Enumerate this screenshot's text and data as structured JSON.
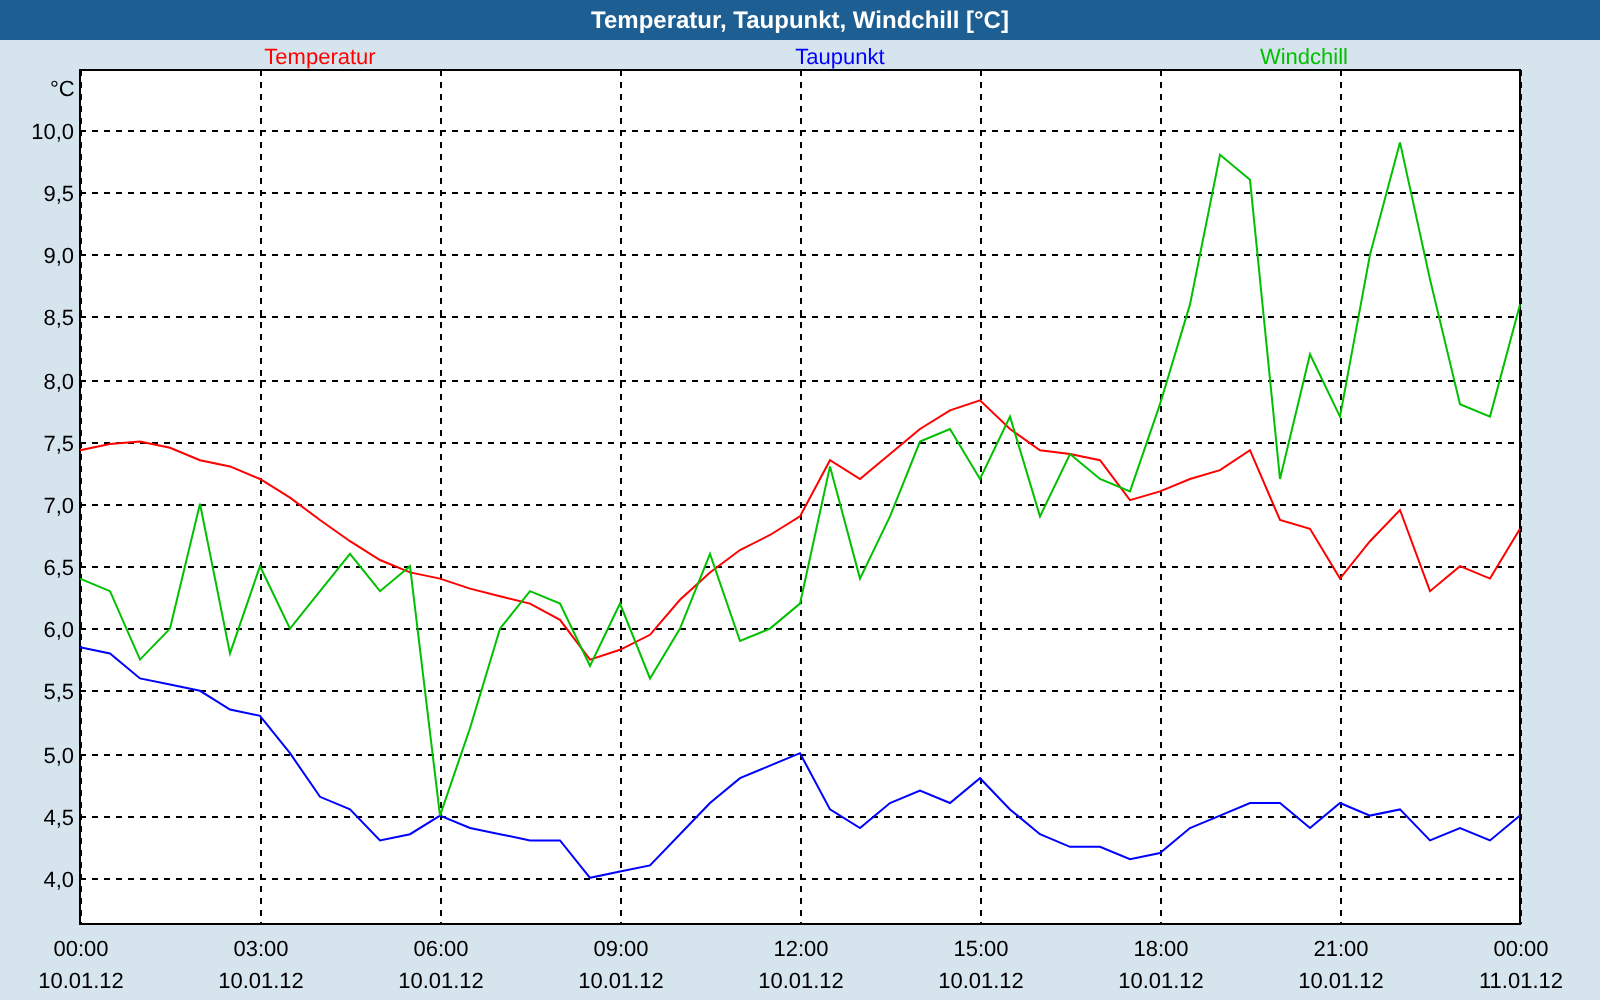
{
  "window": {
    "title": "Temperatur, Taupunkt, Windchill [°C]"
  },
  "chart": {
    "chart_data": {
      "type": "line",
      "ylabel": "°C",
      "categories": [
        "00:00 10.01.12",
        null,
        null,
        null,
        null,
        null,
        "03:00 10.01.12",
        null,
        null,
        null,
        null,
        null,
        "06:00 10.01.12",
        null,
        null,
        null,
        null,
        null,
        "09:00 10.01.12",
        null,
        null,
        null,
        null,
        null,
        "12:00 10.01.12",
        null,
        null,
        null,
        null,
        null,
        "15:00 10.01.12",
        null,
        null,
        null,
        null,
        null,
        "18:00 10.01.12",
        null,
        null,
        null,
        null,
        null,
        "21:00 10.01.12",
        null,
        null,
        null,
        null,
        null,
        "00:00 11.01.12"
      ],
      "series": [
        {
          "name": "Temperatur",
          "color": "#ff0000",
          "values": [
            7.43,
            7.48,
            7.5,
            7.45,
            7.35,
            7.3,
            7.2,
            7.05,
            6.87,
            6.7,
            6.55,
            6.45,
            6.4,
            6.32,
            6.26,
            6.2,
            6.07,
            5.75,
            5.83,
            5.95,
            6.23,
            6.45,
            6.63,
            6.75,
            6.9,
            7.35,
            7.2,
            7.4,
            7.6,
            7.75,
            7.83,
            7.6,
            7.43,
            7.4,
            7.35,
            7.03,
            7.1,
            7.2,
            7.27,
            7.43,
            6.87,
            6.8,
            6.4,
            6.7,
            6.95,
            6.3,
            6.5,
            6.4,
            6.8
          ]
        },
        {
          "name": "Taupunkt",
          "color": "#0000ff",
          "values": [
            5.85,
            5.8,
            5.6,
            5.55,
            5.5,
            5.35,
            5.3,
            5.0,
            4.65,
            4.55,
            4.3,
            4.35,
            4.5,
            4.4,
            4.35,
            4.3,
            4.3,
            4.0,
            4.05,
            4.1,
            4.35,
            4.6,
            4.8,
            4.9,
            5.0,
            4.55,
            4.4,
            4.6,
            4.7,
            4.6,
            4.8,
            4.55,
            4.35,
            4.25,
            4.25,
            4.15,
            4.2,
            4.4,
            4.5,
            4.6,
            4.6,
            4.4,
            4.6,
            4.5,
            4.55,
            4.3,
            4.4,
            4.3,
            4.5
          ]
        },
        {
          "name": "Windchill",
          "color": "#00c000",
          "values": [
            6.4,
            6.3,
            5.75,
            6.0,
            7.0,
            5.8,
            6.5,
            6.0,
            6.3,
            6.6,
            6.3,
            6.5,
            4.5,
            5.2,
            6.0,
            6.3,
            6.2,
            5.7,
            6.2,
            5.6,
            6.0,
            6.6,
            5.9,
            6.0,
            6.2,
            7.3,
            6.4,
            6.9,
            7.5,
            7.6,
            7.2,
            7.7,
            6.9,
            7.4,
            7.2,
            7.1,
            7.8,
            8.6,
            9.8,
            9.6,
            7.2,
            8.2,
            7.7,
            9.0,
            9.9,
            8.8,
            7.8,
            7.7,
            8.6
          ]
        }
      ],
      "ylim": [
        3.63,
        10.48
      ],
      "grid": true,
      "yticks": [
        {
          "value": 4,
          "label": "4,0"
        },
        {
          "value": 4.5,
          "label": "4,5"
        },
        {
          "value": 5,
          "label": "5,0"
        },
        {
          "value": 5.5,
          "label": "5,5"
        },
        {
          "value": 6,
          "label": "6,0"
        },
        {
          "value": 6.5,
          "label": "6,5"
        },
        {
          "value": 7,
          "label": "7,0"
        },
        {
          "value": 7.5,
          "label": "7,5"
        },
        {
          "value": 8,
          "label": "8,0"
        },
        {
          "value": 8.5,
          "label": "8,5"
        },
        {
          "value": 9,
          "label": "9,0"
        },
        {
          "value": 9.5,
          "label": "9,5"
        },
        {
          "value": 10,
          "label": "10,0"
        }
      ]
    }
  }
}
